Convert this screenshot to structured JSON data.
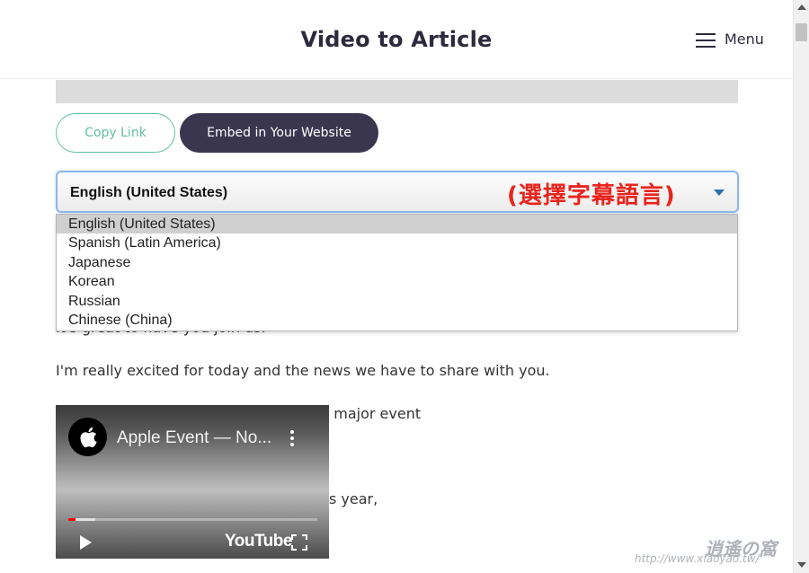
{
  "header": {
    "title": "Video to Article",
    "menu_label": "Menu"
  },
  "actions": {
    "copy_link": "Copy Link",
    "embed": "Embed in Your Website"
  },
  "language_select": {
    "selected": "English (United States)",
    "annotation": "(選擇字幕語言)",
    "options": [
      "English (United States)",
      "Spanish (Latin America)",
      "Japanese",
      "Korean",
      "Russian",
      "Chinese (China)"
    ]
  },
  "article": {
    "line1": "It's great to have you join us.",
    "line2": "I'm really excited for today and the news we have to share with you.",
    "line3_tail": "d major event",
    "line4_tail": "s year,"
  },
  "video": {
    "title": "Apple Event — No...",
    "brand": "YouTube",
    "progress_played": 0.03,
    "progress_loaded": 0.11
  },
  "watermark": {
    "main": "逍遙の窩",
    "url": "http://www.xiaoyao.tw/"
  },
  "colors": {
    "accent_green": "#5fbf9a",
    "dark_button": "#3b3650",
    "annotation_red": "#e8251d",
    "select_focus": "#8fb6e8"
  }
}
